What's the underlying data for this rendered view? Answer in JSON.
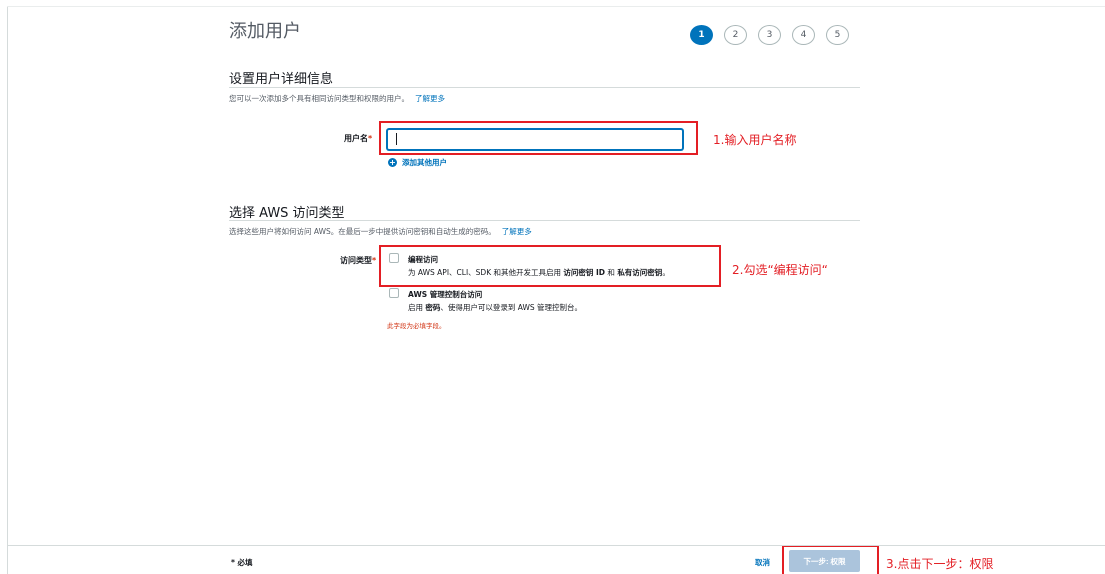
{
  "page": {
    "title": "添加用户"
  },
  "steps": [
    "1",
    "2",
    "3",
    "4",
    "5"
  ],
  "details_section": {
    "title": "设置用户详细信息",
    "description": "您可以一次添加多个具有相同访问类型和权限的用户。",
    "learn_more": "了解更多",
    "username_label": "用户名",
    "username_value": "",
    "add_other_user": "添加其他用户"
  },
  "access_section": {
    "title": "选择 AWS 访问类型",
    "description": "选择这些用户将如何访问 AWS。在最后一步中提供访问密钥和自动生成的密码。",
    "learn_more": "了解更多",
    "access_type_label": "访问类型",
    "option_programmatic": {
      "title": "编程访问",
      "desc_prefix": "为 AWS API、CLI、SDK 和其他开发工具启用 ",
      "desc_key1": "访问密钥 ID",
      "desc_mid": " 和 ",
      "desc_key2": "私有访问密钥",
      "desc_suffix": "。"
    },
    "option_console": {
      "title": "AWS 管理控制台访问",
      "desc_prefix": "启用 ",
      "desc_key": "密码",
      "desc_suffix": "、使得用户可以登录到 AWS 管理控制台。"
    },
    "error_text": "此字段为必填字段。"
  },
  "annotations": {
    "step1": "1.输入用户名称",
    "step2": "2.勾选“编程访问“",
    "step3": "3.点击下一步：权限",
    "color": "#e31e24"
  },
  "footer": {
    "required_note": "* 必填",
    "cancel": "取消",
    "next": "下一步: 权限"
  },
  "colors": {
    "accent": "#0073bb",
    "error": "#d13212",
    "button_disabled": "#abc4dc"
  }
}
